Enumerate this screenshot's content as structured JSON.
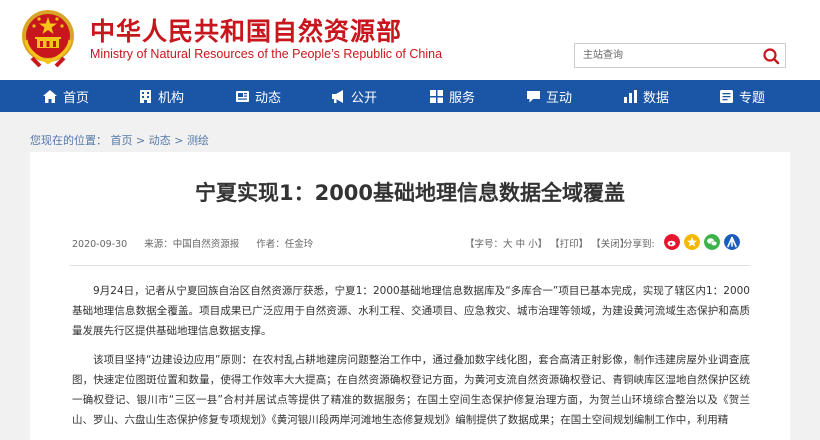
{
  "header": {
    "org_name_cn": "中华人民共和国自然资源部",
    "org_name_en": "Ministry of Natural Resources of the People’s Republic of China",
    "search_placeholder": "主站查询"
  },
  "nav": [
    {
      "label": "首页",
      "icon": "home-icon"
    },
    {
      "label": "机构",
      "icon": "building-icon"
    },
    {
      "label": "动态",
      "icon": "news-icon"
    },
    {
      "label": "公开",
      "icon": "megaphone-icon"
    },
    {
      "label": "服务",
      "icon": "service-icon"
    },
    {
      "label": "互动",
      "icon": "chat-icon"
    },
    {
      "label": "数据",
      "icon": "chart-icon"
    },
    {
      "label": "专题",
      "icon": "topic-icon"
    }
  ],
  "breadcrumb": {
    "prefix": "您现在的位置：",
    "items": [
      "首页",
      "动态",
      "测绘"
    ],
    "separator": ">"
  },
  "article": {
    "title": "宁夏实现1：2000基础地理信息数据全域覆盖",
    "date": "2020-09-30",
    "source": "来源：中国自然资源报",
    "author": "作者：任金玲",
    "font_size_label": "【字号：",
    "font_large": "大",
    "font_medium": "中",
    "font_small": "小",
    "font_size_end": "】",
    "print": "【打印】",
    "close": "【关闭】",
    "share_label": "分享到:",
    "paragraphs": [
      "9月24日，记者从宁夏回族自治区自然资源厅获悉，宁夏1：2000基础地理信息数据库及“多库合一”项目已基本完成，实现了辖区内1：2000基础地理信息数据全覆盖。项目成果已广泛应用于自然资源、水利工程、交通项目、应急救灾、城市治理等领域，为建设黄河流域生态保护和高质量发展先行区提供基础地理信息数据支撑。",
      "该项目坚持“边建设边应用”原则：在农村乱占耕地建房问题整治工作中，通过叠加数字线化图，套合高清正射影像，制作违建房屋外业调查底图，快速定位图斑位置和数量，使得工作效率大大提高；在自然资源确权登记方面，为黄河支流自然资源确权登记、青铜峡库区湿地自然保护区统一确权登记、银川市“三区一县”合村并居试点等提供了精准的数据服务；在国土空间生态保护修复治理方面，为贺兰山环境综合整治以及《贺兰山、罗山、六盘山生态保护修复专项规划》《黄河银川段两岸河滩地生态修复规划》编制提供了数据成果；在国土空间规划编制工作中，利用精"
    ]
  },
  "share_buttons": [
    {
      "name": "weibo-share-icon",
      "color": "#e6162d"
    },
    {
      "name": "qzone-share-icon",
      "color": "#f5b800"
    },
    {
      "name": "wechat-share-icon",
      "color": "#3bb34a"
    },
    {
      "name": "renren-share-icon",
      "color": "#1c5dbc"
    }
  ],
  "colors": {
    "brand_red": "#c8161d",
    "nav_blue": "#1b55a6",
    "link_blue": "#5579a8"
  }
}
